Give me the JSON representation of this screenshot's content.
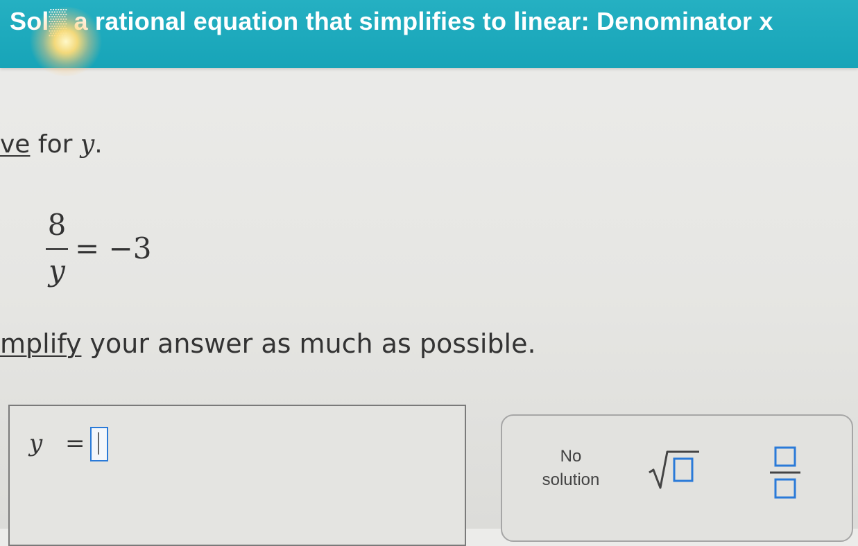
{
  "header": {
    "title": "Sol▒ a rational equation that simplifies to linear: Denominator x",
    "background_color": "#17a4b8"
  },
  "problem": {
    "instruction_link": "ve",
    "instruction_rest": " for ",
    "variable": "y",
    "instruction_end": ".",
    "equation": {
      "numerator": "8",
      "denominator": "y",
      "rhs": "= −3"
    },
    "simplify_link": "mplify",
    "simplify_rest": " your answer as much as possible."
  },
  "answer": {
    "label": "y",
    "equals": "=",
    "input_value": "",
    "input_border_color": "#2a7ad8"
  },
  "keypad": {
    "no_solution_line1": "No",
    "no_solution_line2": "solution",
    "sqrt_icon": "square-root-template-icon",
    "fraction_icon": "fraction-template-icon",
    "icon_color": "#2a7ad8"
  }
}
